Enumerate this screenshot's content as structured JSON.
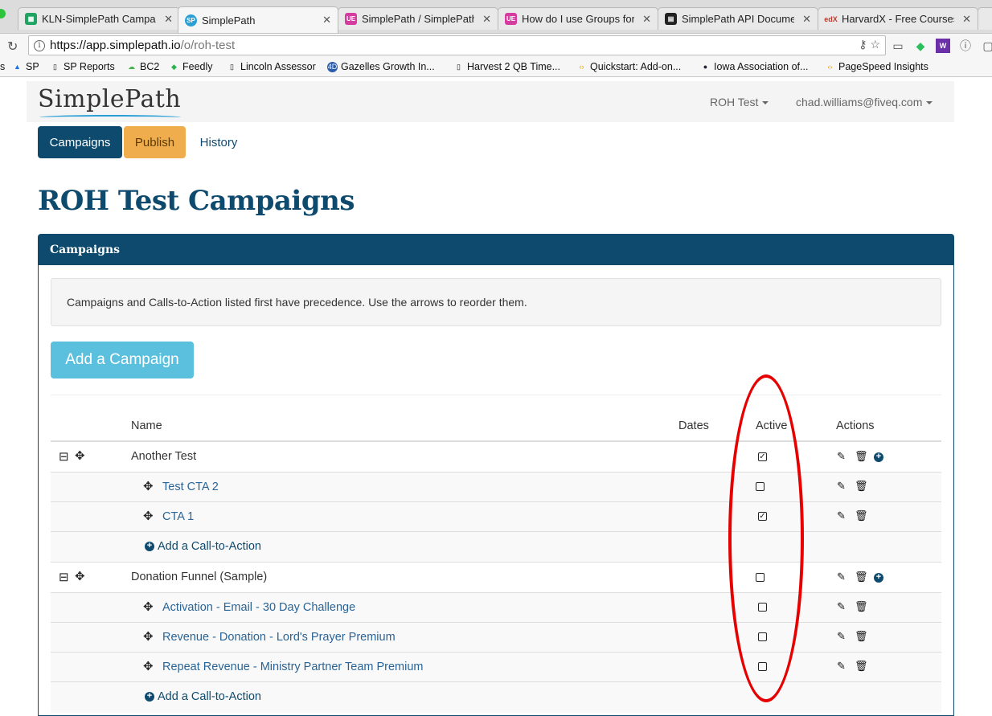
{
  "browser": {
    "tabs": [
      {
        "title": "KLN-SimplePath Campa",
        "icon": "sheets-icon",
        "color": "#1fa463"
      },
      {
        "title": "SimplePath",
        "icon": "sp-icon",
        "color": "#2a9fd6"
      },
      {
        "title": "SimplePath / SimplePath",
        "icon": "ue-icon",
        "color": "#d63ca0"
      },
      {
        "title": "How do I use Groups for",
        "icon": "ue-icon",
        "color": "#d63ca0"
      },
      {
        "title": "SimplePath API Documen",
        "icon": "book-icon",
        "color": "#222222"
      },
      {
        "title": "HarvardX - Free Courses",
        "icon": "edx-icon",
        "color": "#c0392b"
      }
    ],
    "url_host": "https://app.simplepath.io",
    "url_path": "/o/roh-test",
    "bookmarks": [
      "SP",
      "SP Reports",
      "BC2",
      "Feedly",
      "Lincoln Assessor",
      "Gazelles Growth In...",
      "Harvest 2 QB Time...",
      "Quickstart: Add-on...",
      "Iowa Association of...",
      "PageSpeed Insights"
    ]
  },
  "app": {
    "brand": "SimplePath",
    "org_menu": "ROH Test",
    "user_menu": "chad.williams@fiveq.com",
    "nav": {
      "campaigns": "Campaigns",
      "publish": "Publish",
      "history": "History"
    },
    "page_title": "ROH Test Campaigns",
    "panel_title": "Campaigns",
    "notice": "Campaigns and Calls-to-Action listed first have precedence. Use the arrows to reorder them.",
    "add_campaign": "Add a Campaign",
    "columns": {
      "name": "Name",
      "dates": "Dates",
      "active": "Active",
      "actions": "Actions"
    },
    "add_cta": "Add a Call-to-Action",
    "rows": [
      {
        "name": "Another Test",
        "type": "campaign",
        "active": true
      },
      {
        "name": "Test CTA 2",
        "type": "cta",
        "active": false
      },
      {
        "name": "CTA 1",
        "type": "cta",
        "active": true
      },
      {
        "name": "Add a Call-to-Action",
        "type": "add"
      },
      {
        "name": "Donation Funnel (Sample)",
        "type": "campaign",
        "active": false
      },
      {
        "name": "Activation - Email - 30 Day Challenge",
        "type": "cta",
        "active": false
      },
      {
        "name": "Revenue - Donation - Lord's Prayer Premium",
        "type": "cta",
        "active": false
      },
      {
        "name": "Repeat Revenue - Ministry Partner Team Premium",
        "type": "cta",
        "active": false
      },
      {
        "name": "Add a Call-to-Action",
        "type": "add"
      }
    ]
  },
  "colors": {
    "primary": "#0e4a6e",
    "publish": "#f0ad4e",
    "info": "#5bc0de",
    "annotation": "#e60000"
  }
}
